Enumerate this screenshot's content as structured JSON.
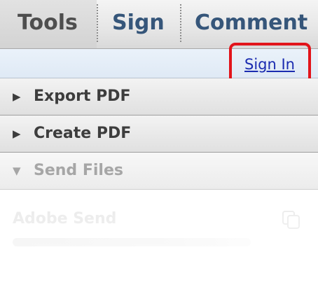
{
  "tabs": {
    "tools": "Tools",
    "sign": "Sign",
    "comment": "Comment"
  },
  "signin": {
    "link_text": "Sign In"
  },
  "panels": [
    {
      "label": "Export PDF",
      "icon": "triangle-right-icon",
      "state": "collapsed"
    },
    {
      "label": "Create PDF",
      "icon": "triangle-right-icon",
      "state": "collapsed"
    },
    {
      "label": "Send Files",
      "icon": "triangle-down-icon",
      "state": "expanded"
    }
  ],
  "send_files": {
    "service_title": "Adobe Send",
    "service_icon": "copy-icon"
  },
  "colors": {
    "highlight": "#e2141b",
    "link": "#1a2bb0",
    "tab_text_active": "#4e4e4e",
    "tab_text": "#36567a"
  }
}
